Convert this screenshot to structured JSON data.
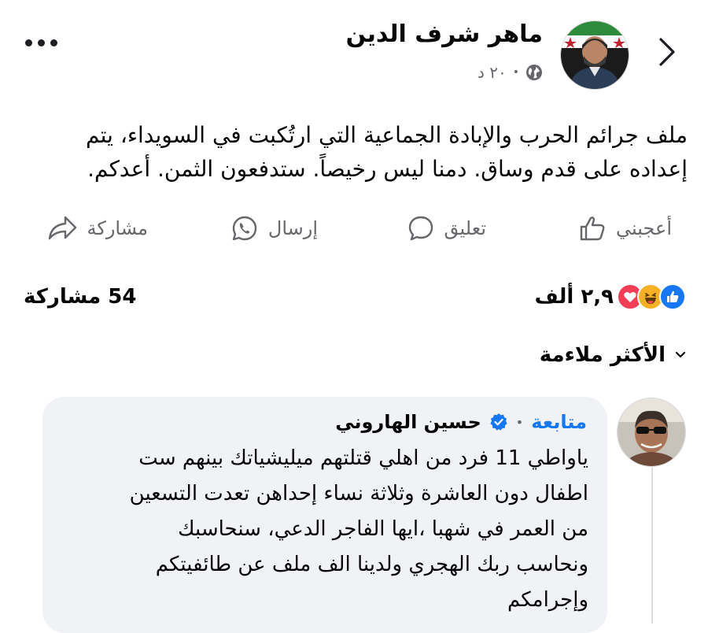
{
  "post": {
    "author_name": "ماهر شرف الدين",
    "time": "٢٠ د",
    "audience_icon": "globe-icon",
    "text_line1": "ملف جرائم الحرب والإبادة الجماعية التي ارتُكبت في السويداء، يتم",
    "text_line2": "إعداده على قدم وساق. دمنا ليس رخيصاً. ستدفعون الثمن. أعدكم."
  },
  "actions": {
    "like": "أعجبني",
    "comment": "تعليق",
    "send": "إرسال",
    "share": "مشاركة"
  },
  "stats": {
    "reaction_count": "٢,٩ ألف",
    "reactions": [
      "like",
      "haha",
      "love"
    ],
    "shares": "54 مشاركة"
  },
  "sort": {
    "label": "الأكثر ملاءمة"
  },
  "comment": {
    "author_name": "حسين الهاروني",
    "verified": true,
    "follow_label": "متابعة",
    "lines": [
      "ياواطي 11 فرد من اهلي قتلتهم ميليشياتك بينهم ست",
      "اطفال دون العاشرة وثلاثة نساء إحداهن تعدت التسعين",
      "من العمر في شهبا ،ايها الفاجر الدعي، سنحاسبك",
      "ونحاسب ربك الهجري ولدينا الف ملف عن طائفيتكم",
      "وإجرامكم"
    ]
  },
  "colors": {
    "accent": "#1877f2",
    "secondary_text": "#65676b",
    "bubble": "#f0f2f5",
    "love": "#f33e58",
    "haha": "#f7b125"
  }
}
